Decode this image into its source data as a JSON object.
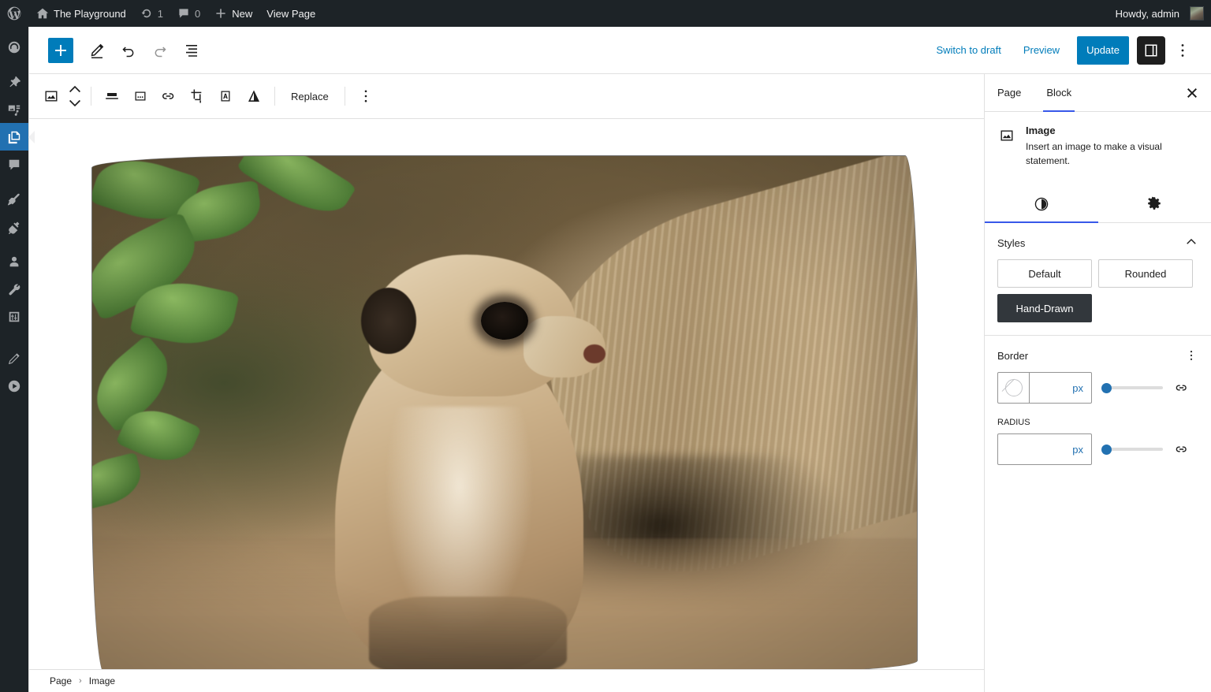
{
  "adminbar": {
    "logo_icon": "wordpress-logo-icon",
    "site": {
      "icon": "home-icon",
      "label": "The Playground"
    },
    "updates": {
      "icon": "updates-icon",
      "count": "1"
    },
    "comments": {
      "icon": "comment-bubble-icon",
      "count": "0"
    },
    "new": {
      "icon": "plus-icon",
      "label": "New"
    },
    "view_page": {
      "label": "View Page"
    },
    "howdy": {
      "label": "Howdy, admin",
      "avatar": "user-avatar"
    }
  },
  "adminmenu": {
    "items": [
      {
        "name": "dashboard",
        "icon": "dashboard-icon",
        "current": false
      },
      {
        "name": "posts",
        "icon": "pin-icon",
        "current": false
      },
      {
        "name": "media",
        "icon": "media-icon",
        "current": false
      },
      {
        "name": "pages",
        "icon": "pages-icon",
        "current": true
      },
      {
        "name": "comments",
        "icon": "comment-icon",
        "current": false
      },
      {
        "name": "appearance",
        "icon": "paintbrush-icon",
        "current": false
      },
      {
        "name": "plugins",
        "icon": "plug-icon",
        "current": false
      },
      {
        "name": "users",
        "icon": "user-icon",
        "current": false
      },
      {
        "name": "tools",
        "icon": "wrench-icon",
        "current": false
      },
      {
        "name": "settings",
        "icon": "settings-sliders-icon",
        "current": false
      },
      {
        "name": "edit",
        "icon": "pencil-icon",
        "current": false
      },
      {
        "name": "play",
        "icon": "play-circle-icon",
        "current": false
      }
    ]
  },
  "header": {
    "add_block": {
      "label": "+",
      "icon": "plus-icon",
      "tooltip": "Add block"
    },
    "tools": {
      "icon": "pencil-icon",
      "tooltip": "Tools"
    },
    "undo": {
      "icon": "undo-icon",
      "tooltip": "Undo",
      "disabled": false
    },
    "redo": {
      "icon": "redo-icon",
      "tooltip": "Redo",
      "disabled": true
    },
    "list_view": {
      "icon": "list-view-icon",
      "tooltip": "Document Overview"
    },
    "switch_to_draft": "Switch to draft",
    "preview": "Preview",
    "update": "Update",
    "settings_toggle": {
      "icon": "sidebar-panel-icon",
      "tooltip": "Settings",
      "pressed": true
    },
    "options": {
      "icon": "kebab-menu-icon",
      "tooltip": "Options"
    }
  },
  "block_toolbar": {
    "block_type": {
      "icon": "image-block-icon",
      "tooltip": "Image"
    },
    "move_up": {
      "icon": "chevron-up-icon"
    },
    "move_down": {
      "icon": "chevron-down-icon"
    },
    "align": {
      "icon": "align-icon",
      "tooltip": "Align"
    },
    "caption": {
      "icon": "caption-box-icon",
      "tooltip": "Add caption"
    },
    "link": {
      "icon": "link-icon",
      "tooltip": "Link"
    },
    "crop": {
      "icon": "crop-icon",
      "tooltip": "Crop"
    },
    "text_over": {
      "icon": "add-text-over-image-icon",
      "tooltip": "Add text over image"
    },
    "duotone": {
      "icon": "duotone-filter-icon",
      "tooltip": "Apply duotone filter"
    },
    "replace": "Replace",
    "more_options": {
      "icon": "kebab-menu-icon",
      "tooltip": "Options"
    }
  },
  "canvas": {
    "image": {
      "alt": "Meerkat standing on dirt beside a fallen log with green leaves at left",
      "style": "hand-drawn"
    }
  },
  "breadcrumb": {
    "items": [
      "Page",
      "Image"
    ],
    "separator": "›"
  },
  "sidebar": {
    "tabs": [
      {
        "label": "Page",
        "active": false
      },
      {
        "label": "Block",
        "active": true
      }
    ],
    "close": {
      "icon": "close-icon"
    },
    "block_card": {
      "icon": "image-block-icon",
      "title": "Image",
      "description": "Insert an image to make a visual statement."
    },
    "inspector_tabs": [
      {
        "name": "styles",
        "icon": "contrast-half-circle-icon",
        "active": true
      },
      {
        "name": "settings",
        "icon": "gear-icon",
        "active": false
      }
    ],
    "styles_panel": {
      "title": "Styles",
      "collapse_icon": "chevron-up-icon",
      "options": [
        {
          "label": "Default",
          "selected": false
        },
        {
          "label": "Rounded",
          "selected": false
        },
        {
          "label": "Hand-Drawn",
          "selected": true
        }
      ]
    },
    "border_panel": {
      "title": "Border",
      "options_icon": "kebab-menu-icon",
      "width": {
        "color_swatch": "no-color-swatch",
        "value": "",
        "unit": "px",
        "slider_value": 0,
        "link_icon": "link-sides-icon"
      },
      "radius": {
        "label": "RADIUS",
        "value": "",
        "unit": "px",
        "slider_value": 0,
        "link_icon": "link-sides-icon"
      }
    }
  },
  "colors": {
    "admin_dark": "#1d2327",
    "wp_blue": "#2271b1",
    "accent_blue": "#007cba",
    "tab_underline": "#3858e9",
    "selected_dark": "#32373c"
  }
}
